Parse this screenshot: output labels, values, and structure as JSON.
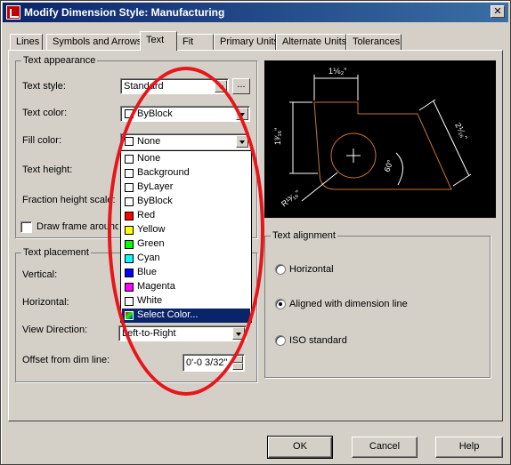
{
  "window": {
    "title": "Modify Dimension Style: Manufacturing",
    "close_glyph": "✕"
  },
  "tabs": [
    "Lines",
    "Symbols and Arrows",
    "Text",
    "Fit",
    "Primary Units",
    "Alternate Units",
    "Tolerances"
  ],
  "active_tab": "Text",
  "text_appearance": {
    "legend": "Text appearance",
    "text_style_label": "Text style:",
    "text_style_value": "Standard",
    "text_style_button": "...",
    "text_color_label": "Text color:",
    "text_color_value": "ByBlock",
    "fill_color_label": "Fill color:",
    "fill_color_value": "None",
    "text_height_label": "Text height:",
    "fraction_height_label": "Fraction height scale:",
    "draw_frame_label": "Draw frame around text"
  },
  "fill_color_dropdown": {
    "items": [
      {
        "label": "None",
        "color": "#ffffff"
      },
      {
        "label": "Background",
        "color": "#ffffff"
      },
      {
        "label": "ByLayer",
        "color": "#ffffff"
      },
      {
        "label": "ByBlock",
        "color": "#ffffff"
      },
      {
        "label": "Red",
        "color": "#ff0000"
      },
      {
        "label": "Yellow",
        "color": "#ffff00"
      },
      {
        "label": "Green",
        "color": "#00ff00"
      },
      {
        "label": "Cyan",
        "color": "#00ffff"
      },
      {
        "label": "Blue",
        "color": "#0000ff"
      },
      {
        "label": "Magenta",
        "color": "#ff00ff"
      },
      {
        "label": "White",
        "color": "#ffffff"
      },
      {
        "label": "Select Color...",
        "color": "multi"
      }
    ],
    "selected": "Select Color..."
  },
  "text_placement": {
    "legend": "Text placement",
    "vertical_label": "Vertical:",
    "horizontal_label": "Horizontal:",
    "view_direction_label": "View Direction:",
    "view_direction_value": "Left-to-Right",
    "offset_label": "Offset from dim line:",
    "offset_value": "0'-0 3/32\""
  },
  "text_alignment": {
    "legend": "Text alignment",
    "options": [
      "Horizontal",
      "Aligned with dimension line",
      "ISO standard"
    ],
    "selected": "Aligned with dimension line"
  },
  "preview_dims": {
    "top": "1⅙₂\"",
    "left": "1³⁄₁₆\"",
    "right": "2⅟₁₆\"",
    "angle": "60°",
    "radius": "R¹³⁄₁₆\""
  },
  "buttons": {
    "ok": "OK",
    "cancel": "Cancel",
    "help": "Help"
  },
  "colors": {
    "annotation": "#e8151b",
    "selection": "#0a246a",
    "preview_geometry": "#c87533"
  }
}
